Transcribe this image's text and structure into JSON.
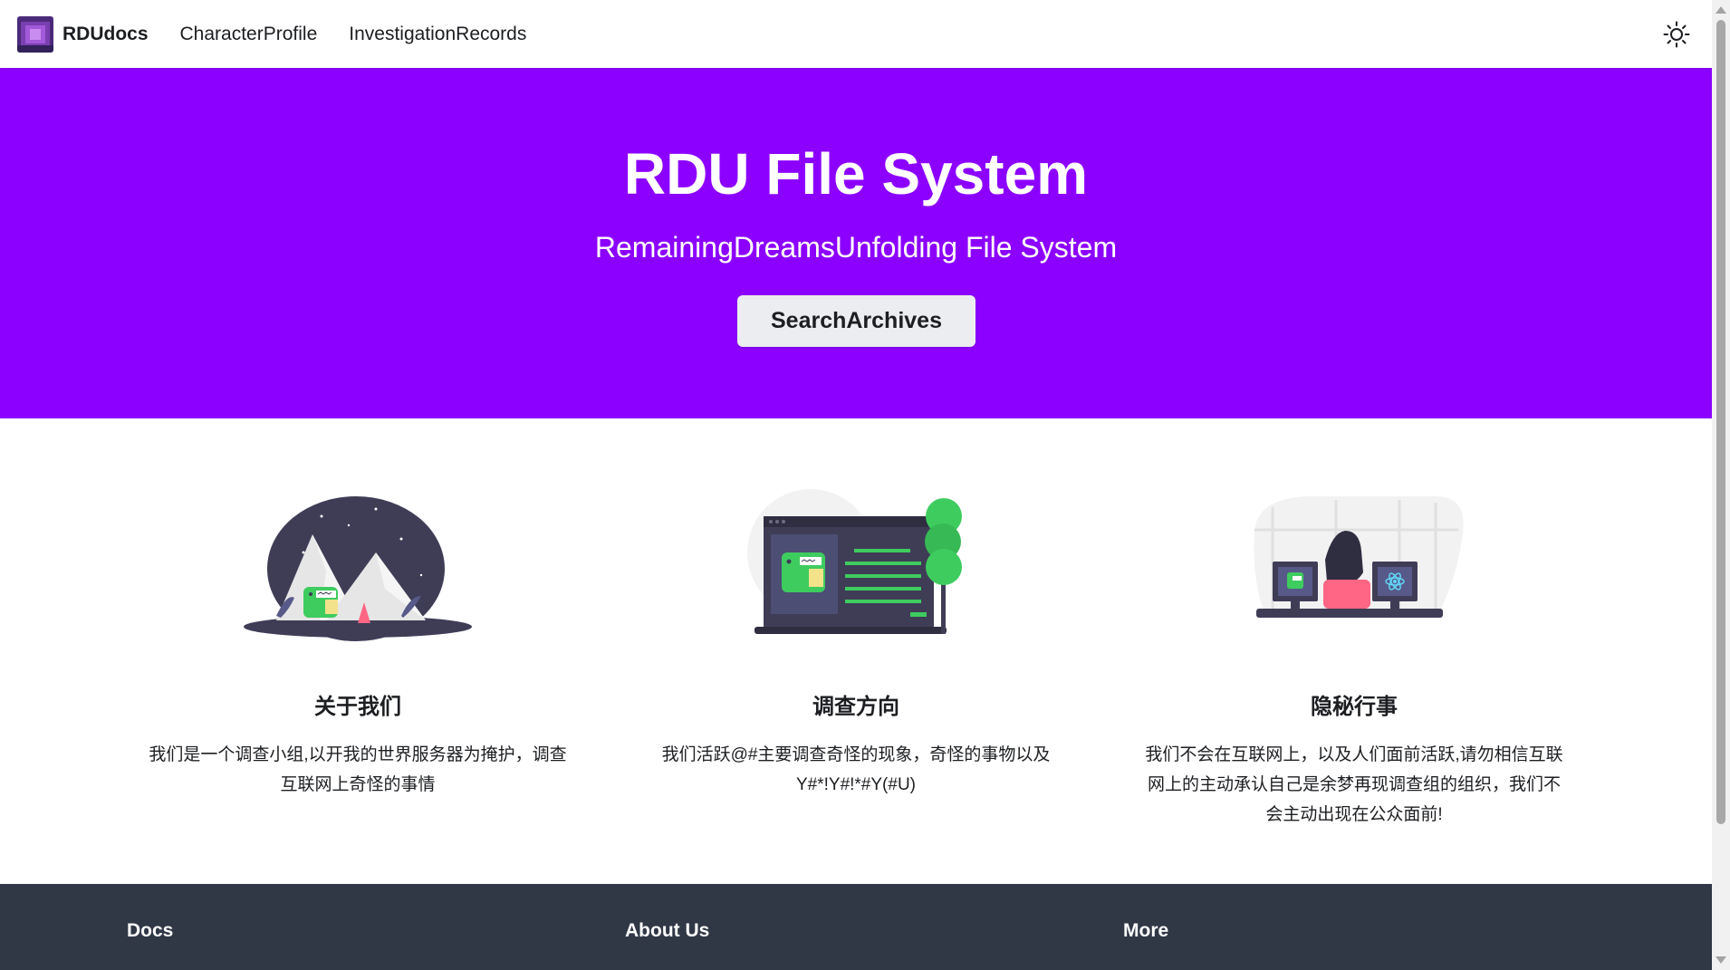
{
  "navbar": {
    "brand": "RDUdocs",
    "links": [
      "CharacterProfile",
      "InvestigationRecords"
    ]
  },
  "hero": {
    "title": "RDU File System",
    "subtitle": "RemainingDreamsUnfolding File System",
    "button_label": "SearchArchives"
  },
  "features": [
    {
      "title": "关于我们",
      "description": "我们是一个调查小组,以开我的世界服务器为掩护，调查互联网上奇怪的事情"
    },
    {
      "title": "调查方向",
      "description": "我们活跃@#主要调查奇怪的现象，奇怪的事物以及Y#*!Y#!*#Y(#U)"
    },
    {
      "title": "隐秘行事",
      "description": "我们不会在互联网上，以及人们面前活跃,请勿相信互联网上的主动承认自己是余梦再现调查组的组织，我们不会主动出现在公众面前!"
    }
  ],
  "footer": {
    "columns": [
      "Docs",
      "About Us",
      "More"
    ]
  },
  "colors": {
    "primary": "#8c00ff",
    "footer_bg": "#303846",
    "button_bg": "#ebedf0"
  },
  "icons": {
    "theme_toggle": "sun-icon"
  }
}
